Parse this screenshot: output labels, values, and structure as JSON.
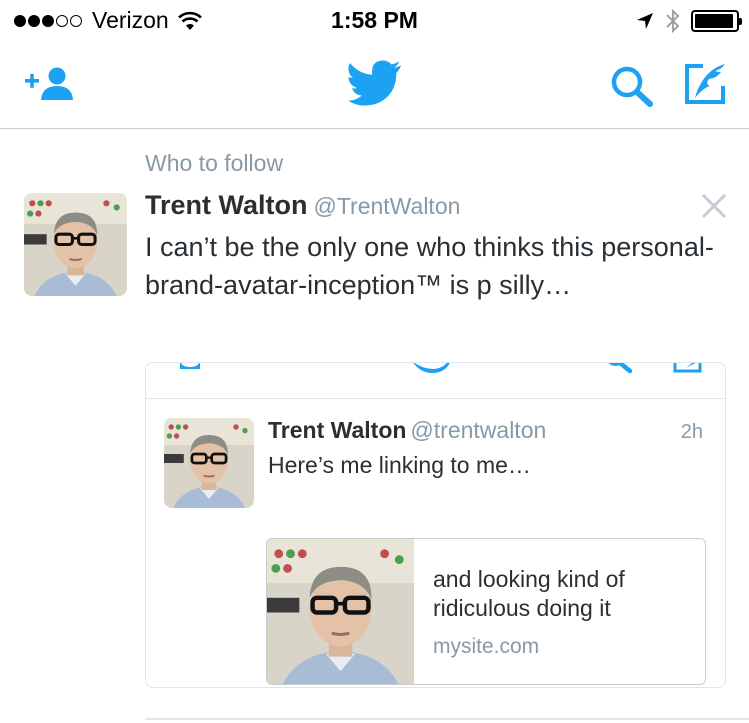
{
  "status_bar": {
    "carrier": "Verizon",
    "signal_bars_filled": 3,
    "signal_bars_total": 5,
    "time": "1:58 PM",
    "battery_level": 0.95
  },
  "nav_bar": {
    "left_icon": "add-user-icon",
    "center_icon": "twitter-bird-icon",
    "right_icons": [
      "search-icon",
      "compose-icon"
    ],
    "accent_color": "#1da1f2"
  },
  "section_label": "Who to follow",
  "tweet": {
    "name": "Trent Walton",
    "handle": "@TrentWalton",
    "text": "I can’t be the only one who thinks this personal-brand-avatar-inception™ is p silly…"
  },
  "embedded_tweet": {
    "name": "Trent Walton",
    "handle": "@trentwalton",
    "time": "2h",
    "text": "Here’s me linking to me…",
    "card": {
      "text": "and looking kind of ridiculous doing it",
      "domain": "mysite.com"
    }
  }
}
